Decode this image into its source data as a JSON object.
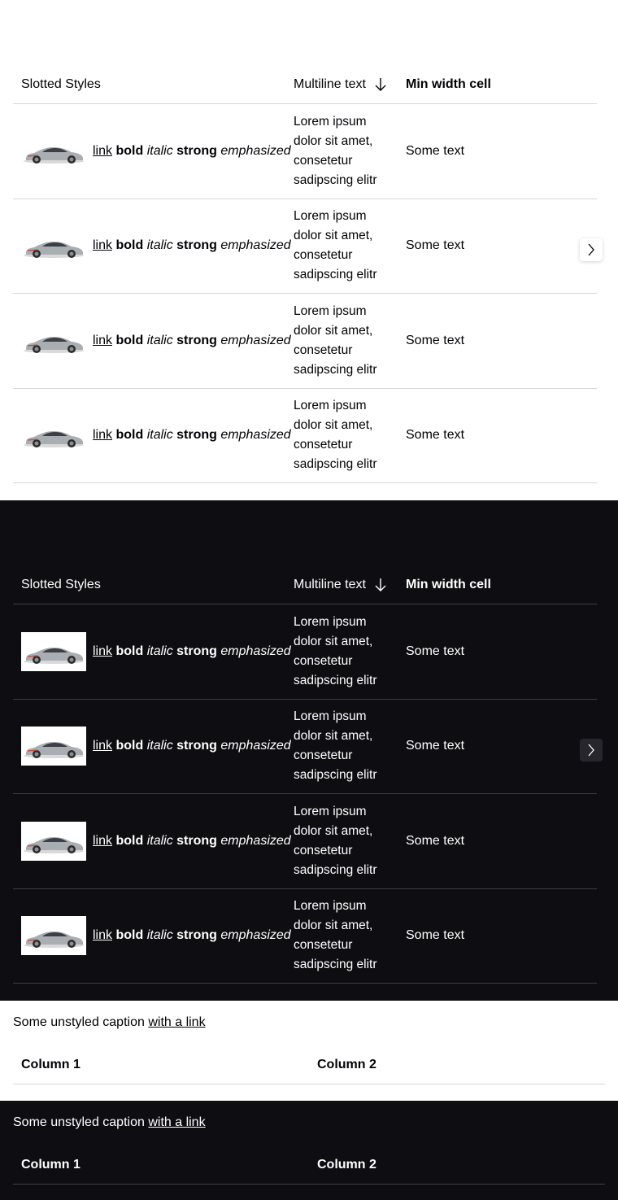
{
  "tables": [
    {
      "theme": "light",
      "headers": {
        "col1": "Slotted Styles",
        "col2": "Multiline text",
        "col3": "Min width cell"
      },
      "rows": [
        {
          "link": "link",
          "bold": "bold",
          "italic": "italic",
          "strong": "strong",
          "emphasized": "emphasized",
          "multiline": [
            "Lorem ipsum",
            "dolor sit amet,",
            "consetetur",
            "sadipscing elitr"
          ],
          "text": "Some text"
        },
        {
          "link": "link",
          "bold": "bold",
          "italic": "italic",
          "strong": "strong",
          "emphasized": "emphasized",
          "multiline": [
            "Lorem ipsum",
            "dolor sit amet,",
            "consetetur",
            "sadipscing elitr"
          ],
          "text": "Some text"
        },
        {
          "link": "link",
          "bold": "bold",
          "italic": "italic",
          "strong": "strong",
          "emphasized": "emphasized",
          "multiline": [
            "Lorem ipsum",
            "dolor sit amet,",
            "consetetur",
            "sadipscing elitr"
          ],
          "text": "Some text"
        },
        {
          "link": "link",
          "bold": "bold",
          "italic": "italic",
          "strong": "strong",
          "emphasized": "emphasized",
          "multiline": [
            "Lorem ipsum",
            "dolor sit amet,",
            "consetetur",
            "sadipscing elitr"
          ],
          "text": "Some text"
        }
      ],
      "icons": {
        "sort": "arrow-down-icon",
        "scroll": "chevron-right-icon",
        "image": "car-icon"
      }
    },
    {
      "theme": "dark",
      "headers": {
        "col1": "Slotted Styles",
        "col2": "Multiline text",
        "col3": "Min width cell"
      },
      "rows": [
        {
          "link": "link",
          "bold": "bold",
          "italic": "italic",
          "strong": "strong",
          "emphasized": "emphasized",
          "multiline": [
            "Lorem ipsum",
            "dolor sit amet,",
            "consetetur",
            "sadipscing elitr"
          ],
          "text": "Some text"
        },
        {
          "link": "link",
          "bold": "bold",
          "italic": "italic",
          "strong": "strong",
          "emphasized": "emphasized",
          "multiline": [
            "Lorem ipsum",
            "dolor sit amet,",
            "consetetur",
            "sadipscing elitr"
          ],
          "text": "Some text"
        },
        {
          "link": "link",
          "bold": "bold",
          "italic": "italic",
          "strong": "strong",
          "emphasized": "emphasized",
          "multiline": [
            "Lorem ipsum",
            "dolor sit amet,",
            "consetetur",
            "sadipscing elitr"
          ],
          "text": "Some text"
        },
        {
          "link": "link",
          "bold": "bold",
          "italic": "italic",
          "strong": "strong",
          "emphasized": "emphasized",
          "multiline": [
            "Lorem ipsum",
            "dolor sit amet,",
            "consetetur",
            "sadipscing elitr"
          ],
          "text": "Some text"
        }
      ],
      "icons": {
        "sort": "arrow-down-icon",
        "scroll": "chevron-right-icon",
        "image": "car-icon"
      }
    }
  ],
  "captions": [
    {
      "theme": "light",
      "text": "Some unstyled caption ",
      "link": "with a link",
      "col1": "Column 1",
      "col2": "Column 2"
    },
    {
      "theme": "dark",
      "text": "Some unstyled caption ",
      "link": "with a link",
      "col1": "Column 1",
      "col2": "Column 2"
    }
  ],
  "colors": {
    "light_bg": "#ffffff",
    "dark_bg": "#0e0e12",
    "light_text": "#010205",
    "dark_text": "#ffffff",
    "light_divider": "#d8d8db",
    "dark_divider": "#3b3b42"
  }
}
